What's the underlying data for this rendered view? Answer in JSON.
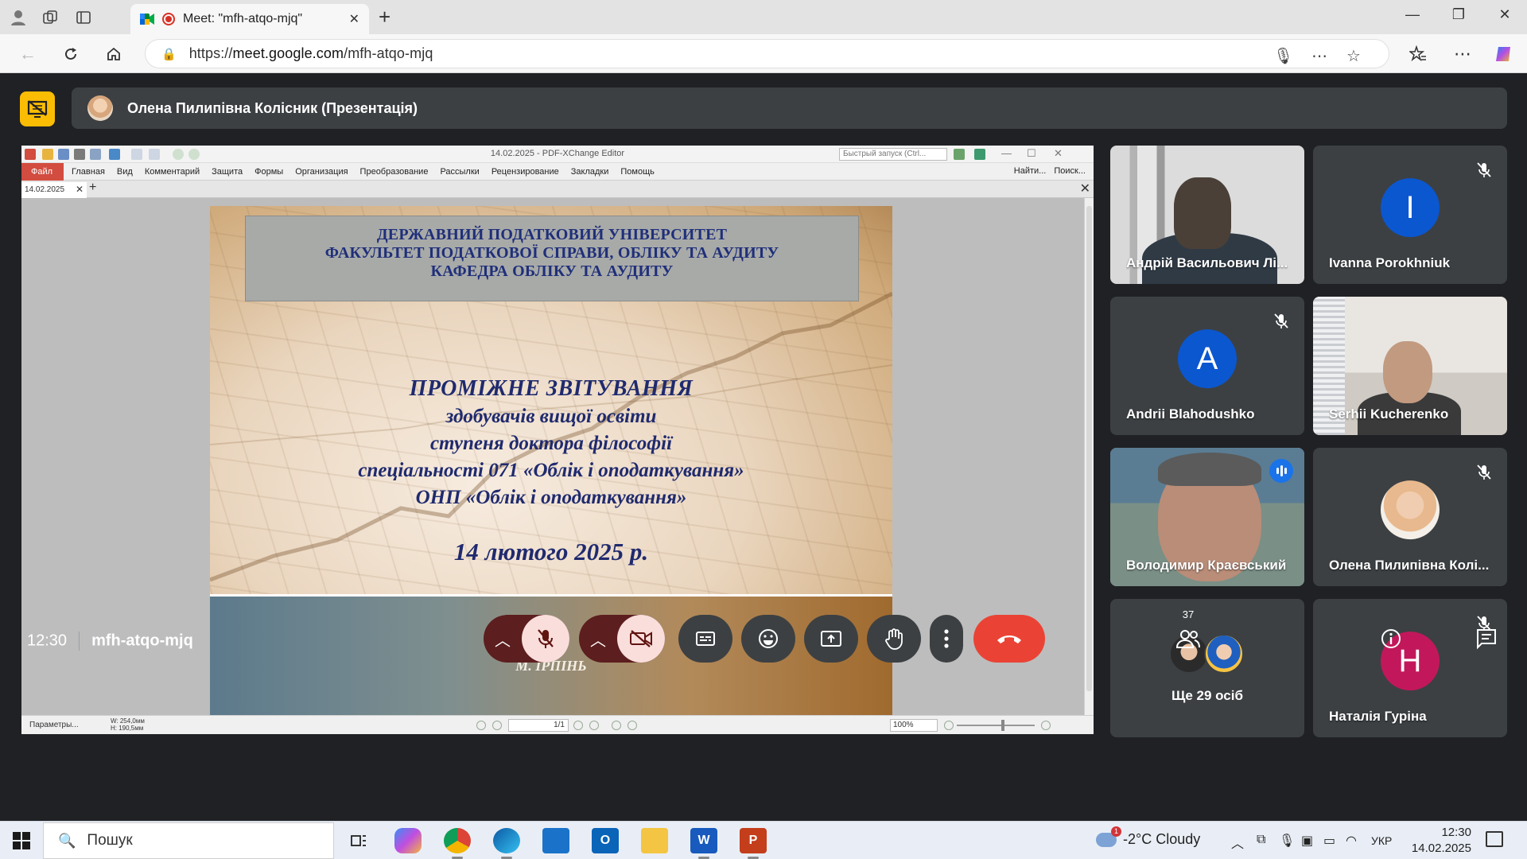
{
  "browser": {
    "tab_title": "Meet: \"mfh-atqo-mjq\"",
    "url_prefix": "https://",
    "url_host": "meet.google.com",
    "url_path": "/mfh-atqo-mjq"
  },
  "meet": {
    "presenter_label": "Олена Пилипівна Колісник (Презентація)",
    "time": "12:30",
    "meeting_code": "mfh-atqo-mjq",
    "participant_count": "37",
    "colors": {
      "accent_blue": "#1a73e8",
      "end_call": "#ea4335",
      "stop_presenting": "#fbbc04",
      "tile_bg": "#3c4043"
    }
  },
  "pdf_editor": {
    "app_title": "14.02.2025 - PDF-XChange Editor",
    "quick_search_placeholder": "Быстрый запуск (Ctrl...",
    "menu": [
      "Главная",
      "Вид",
      "Комментарий",
      "Защита",
      "Формы",
      "Организация",
      "Преобразование",
      "Рассылки",
      "Рецензирование",
      "Закладки",
      "Помощь"
    ],
    "menu_file": "Файл",
    "find_label": "Найти...",
    "search_label": "Поиск...",
    "doc_tab": "14.02.2025",
    "params_label": "Параметры...",
    "dims_w": "W: 254,0мм",
    "dims_h": "H: 190,5мм",
    "page_indicator": "1/1",
    "zoom": "100%"
  },
  "slide": {
    "header": [
      "ДЕРЖАВНИЙ ПОДАТКОВИЙ УНІВЕРСИТЕТ",
      "ФАКУЛЬТЕТ ПОДАТКОВОЇ СПРАВИ, ОБЛІКУ ТА АУДИТУ",
      "КАФЕДРА ОБЛІКУ ТА АУДИТУ"
    ],
    "title": "ПРОМІЖНЕ ЗВІТУВАННЯ",
    "lines": [
      "здобувачів вищої освіти",
      "ступеня доктора філософії",
      "спеціальності 071 «Облік і оподаткування»",
      "ОНП «Облік і оподаткування»"
    ],
    "date": "14 лютого 2025 р.",
    "city": "М. ІРПІНЬ"
  },
  "participants": [
    {
      "name": "Андрій Васильович Лі...",
      "type": "video",
      "muted": false
    },
    {
      "name": "Ivanna Porokhniuk",
      "type": "letter",
      "letter": "I",
      "color": "#0b57d0",
      "muted": true
    },
    {
      "name": "Andrii Blahodushko",
      "type": "letter",
      "letter": "A",
      "color": "#0b57d0",
      "muted": true
    },
    {
      "name": "Serhii Kucherenko",
      "type": "video",
      "muted": false
    },
    {
      "name": "Володимир Краєвський",
      "type": "video",
      "muted": false,
      "speaking": true
    },
    {
      "name": "Олена Пилипівна Колі...",
      "type": "photo",
      "muted": true
    },
    {
      "name": "Ще 29 осіб",
      "type": "more"
    },
    {
      "name": "Наталія Гуріна",
      "type": "letter",
      "letter": "Н",
      "color": "#c2185b",
      "muted": true
    }
  ],
  "taskbar": {
    "search_placeholder": "Пошук",
    "weather": "-2°C Cloudy",
    "lang": "УКР",
    "time": "12:30",
    "date": "14.02.2025"
  }
}
